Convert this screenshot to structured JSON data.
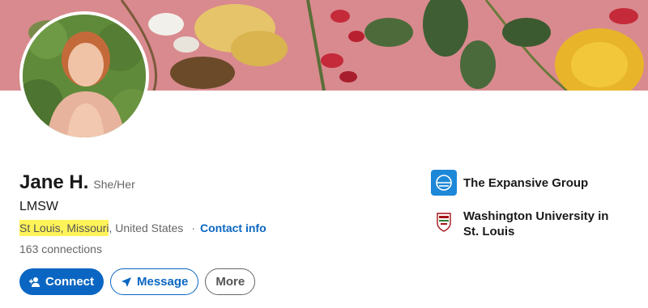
{
  "profile": {
    "name": "Jane H.",
    "pronouns": "She/Her",
    "headline": "LMSW",
    "location_highlighted": "St Louis, Missouri",
    "location_rest": ", United States",
    "separator": "·",
    "contact_link": "Contact info",
    "connections_count": "163",
    "connections_label": "connections"
  },
  "actions": {
    "connect": "Connect",
    "message": "Message",
    "more": "More"
  },
  "organizations": [
    {
      "name": "The Expansive Group",
      "logo_icon": "expansive-group-logo"
    },
    {
      "name": "Washington University in St. Louis",
      "logo_icon": "washu-shield-logo"
    }
  ],
  "colors": {
    "accent": "#0a66c2",
    "highlight": "#fff35a",
    "banner": "#d98a8e"
  }
}
